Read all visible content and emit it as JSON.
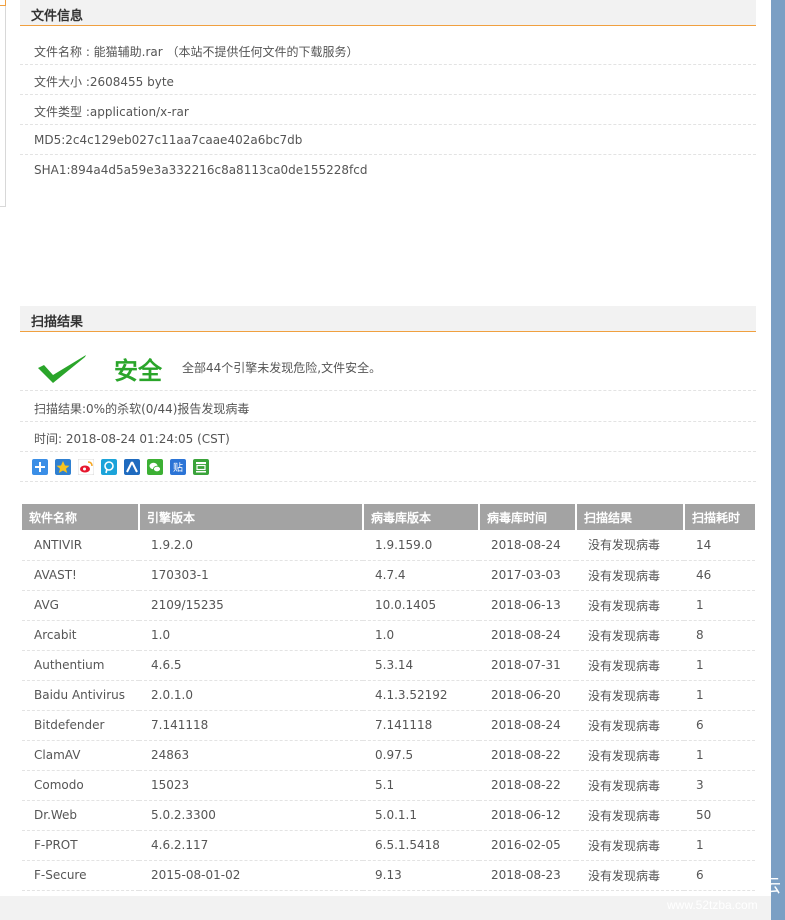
{
  "file_info": {
    "title": "文件信息",
    "rows": [
      "文件名称 : 能猫辅助.rar （本站不提供任何文件的下载服务）",
      "文件大小 :2608455 byte",
      "文件类型 :application/x-rar",
      "MD5:2c4c129eb027c11aa7caae402a6bc7db",
      "SHA1:894a4d5a59e3a332216c8a8113ca0de155228fcd"
    ]
  },
  "scan": {
    "title": "扫描结果",
    "status_label": "安全",
    "status_desc": "全部44个引擎未发现危险,文件安全。",
    "summary": "扫描结果:0%的杀软(0/44)报告发现病毒",
    "time": "时间: 2018-08-24 01:24:05 (CST)",
    "status_color": "#2aa52a"
  },
  "share_icons": [
    "share-plus-icon",
    "qzone-icon",
    "weibo-icon",
    "tencent-weibo-icon",
    "renren-icon",
    "wechat-icon",
    "baidu-tieba-icon",
    "douban-icon"
  ],
  "table": {
    "headers": [
      "软件名称",
      "引擎版本",
      "病毒库版本",
      "病毒库时间",
      "扫描结果",
      "扫描耗时"
    ],
    "rows": [
      [
        "ANTIVIR",
        "1.9.2.0",
        "1.9.159.0",
        "2018-08-24",
        "没有发现病毒",
        "14"
      ],
      [
        "AVAST!",
        "170303-1",
        "4.7.4",
        "2017-03-03",
        "没有发现病毒",
        "46"
      ],
      [
        "AVG",
        "2109/15235",
        "10.0.1405",
        "2018-06-13",
        "没有发现病毒",
        "1"
      ],
      [
        "Arcabit",
        "1.0",
        "1.0",
        "2018-08-24",
        "没有发现病毒",
        "8"
      ],
      [
        "Authentium",
        "4.6.5",
        "5.3.14",
        "2018-07-31",
        "没有发现病毒",
        "1"
      ],
      [
        "Baidu Antivirus",
        "2.0.1.0",
        "4.1.3.52192",
        "2018-06-20",
        "没有发现病毒",
        "1"
      ],
      [
        "Bitdefender",
        "7.141118",
        "7.141118",
        "2018-08-24",
        "没有发现病毒",
        "6"
      ],
      [
        "ClamAV",
        "24863",
        "0.97.5",
        "2018-08-22",
        "没有发现病毒",
        "1"
      ],
      [
        "Comodo",
        "15023",
        "5.1",
        "2018-08-22",
        "没有发现病毒",
        "3"
      ],
      [
        "Dr.Web",
        "5.0.2.3300",
        "5.0.1.1",
        "2018-06-12",
        "没有发现病毒",
        "50"
      ],
      [
        "F-PROT",
        "4.6.2.117",
        "6.5.1.5418",
        "2016-02-05",
        "没有发现病毒",
        "1"
      ],
      [
        "F-Secure",
        "2015-08-01-02",
        "9.13",
        "2018-08-23",
        "没有发现病毒",
        "6"
      ]
    ]
  },
  "watermark": {
    "site": "www.52tzba.com",
    "glyph": "云"
  }
}
